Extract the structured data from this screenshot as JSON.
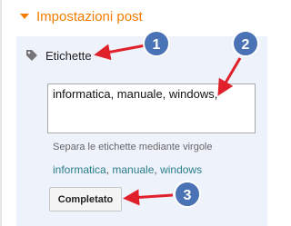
{
  "section": {
    "title": "Impostazioni post",
    "caret_icon": "caret-down-icon",
    "accent_color": "#f57c00"
  },
  "labels": {
    "icon": "tag-icon",
    "title": "Etichette",
    "input_value": "informatica, manuale, windows,",
    "hint": "Separa le etichette mediante virgole",
    "suggestions": [
      "informatica",
      "manuale",
      "windows"
    ],
    "link_color": "#2a7d8c"
  },
  "done_button": {
    "label": "Completato"
  },
  "annotations": {
    "badge_color": "#4a73b5",
    "arrow_color": "#e0202a",
    "steps": [
      "1",
      "2",
      "3"
    ]
  }
}
